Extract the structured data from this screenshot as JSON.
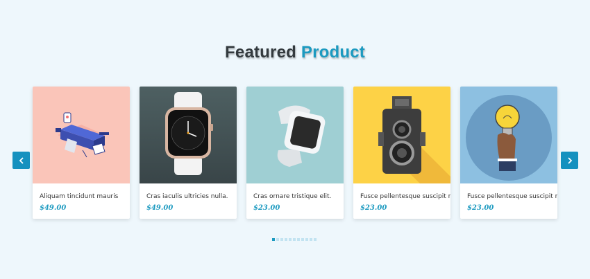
{
  "section": {
    "title_part1": "Featured",
    "title_part2": "Product"
  },
  "carousel": {
    "prev_icon": "chevron-left-icon",
    "next_icon": "chevron-right-icon",
    "products": [
      {
        "title": "Aliquam tincidunt mauris",
        "price": "$49.00",
        "image": "isometric-illustration"
      },
      {
        "title": "Cras iaculis ultricies nulla.",
        "price": "$49.00",
        "image": "apple-watch"
      },
      {
        "title": "Cras ornare tristique elit.",
        "price": "$23.00",
        "image": "smartwatch"
      },
      {
        "title": "Fusce pellentesque suscipit nibh.",
        "price": "$23.00",
        "image": "camera"
      },
      {
        "title": "Fusce pellentesque suscipit nibh.",
        "price": "$23.00",
        "image": "lightbulb"
      }
    ],
    "pagination": {
      "total": 11,
      "active": 1
    }
  },
  "colors": {
    "accent": "#1c9ac0",
    "background": "#eef7fc",
    "heading_dark": "#333a3e"
  }
}
